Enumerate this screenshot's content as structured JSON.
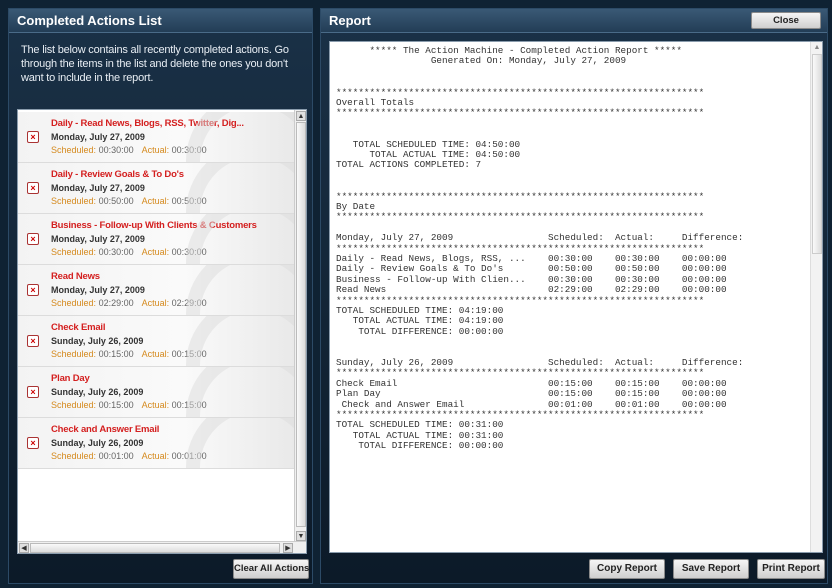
{
  "left_panel": {
    "title": "Completed Actions List",
    "intro": "The list below contains all recently completed actions. Go through the items in the list and delete the ones you don't want to include in the report.",
    "scheduled_label": "Scheduled:",
    "actual_label": "Actual:",
    "delete_glyph": "×",
    "items": [
      {
        "title": "Daily - Read News, Blogs, RSS, Twitter, Dig...",
        "date": "Monday, July 27, 2009",
        "scheduled": "00:30:00",
        "actual": "00:30:00"
      },
      {
        "title": "Daily - Review Goals & To Do's",
        "date": "Monday, July 27, 2009",
        "scheduled": "00:50:00",
        "actual": "00:50:00"
      },
      {
        "title": "Business - Follow-up With Clients & Customers",
        "date": "Monday, July 27, 2009",
        "scheduled": "00:30:00",
        "actual": "00:30:00"
      },
      {
        "title": "Read News",
        "date": "Monday, July 27, 2009",
        "scheduled": "02:29:00",
        "actual": "02:29:00"
      },
      {
        "title": "Check Email",
        "date": "Sunday, July 26, 2009",
        "scheduled": "00:15:00",
        "actual": "00:15:00"
      },
      {
        "title": "Plan Day",
        "date": "Sunday, July 26, 2009",
        "scheduled": "00:15:00",
        "actual": "00:15:00"
      },
      {
        "title": "Check and Answer Email",
        "date": "Sunday, July 26, 2009",
        "scheduled": "00:01:00",
        "actual": "00:01:00"
      }
    ],
    "clear_all_label": "Clear All Actions"
  },
  "right_panel": {
    "title": "Report",
    "close_label": "Close",
    "report_lines": [
      "      ***** The Action Machine - Completed Action Report *****",
      "                 Generated On: Monday, July 27, 2009",
      "",
      "",
      "******************************************************************",
      "Overall Totals",
      "******************************************************************",
      "",
      "",
      "   TOTAL SCHEDULED TIME: 04:50:00",
      "      TOTAL ACTUAL TIME: 04:50:00",
      "TOTAL ACTIONS COMPLETED: 7",
      "",
      "",
      "******************************************************************",
      "By Date",
      "******************************************************************",
      "",
      "Monday, July 27, 2009                 Scheduled:  Actual:     Difference:",
      "******************************************************************",
      "Daily - Read News, Blogs, RSS, ...    00:30:00    00:30:00    00:00:00",
      "Daily - Review Goals & To Do's        00:50:00    00:50:00    00:00:00",
      "Business - Follow-up With Clien...    00:30:00    00:30:00    00:00:00",
      "Read News                             02:29:00    02:29:00    00:00:00",
      "******************************************************************",
      "TOTAL SCHEDULED TIME: 04:19:00",
      "   TOTAL ACTUAL TIME: 04:19:00",
      "    TOTAL DIFFERENCE: 00:00:00",
      "",
      "",
      "Sunday, July 26, 2009                 Scheduled:  Actual:     Difference:",
      "******************************************************************",
      "Check Email                           00:15:00    00:15:00    00:00:00",
      "Plan Day                              00:15:00    00:15:00    00:00:00",
      " Check and Answer Email               00:01:00    00:01:00    00:00:00",
      "******************************************************************",
      "TOTAL SCHEDULED TIME: 00:31:00",
      "   TOTAL ACTUAL TIME: 00:31:00",
      "    TOTAL DIFFERENCE: 00:00:00"
    ],
    "buttons": {
      "copy": "Copy Report",
      "save": "Save Report",
      "print": "Print Report"
    }
  }
}
